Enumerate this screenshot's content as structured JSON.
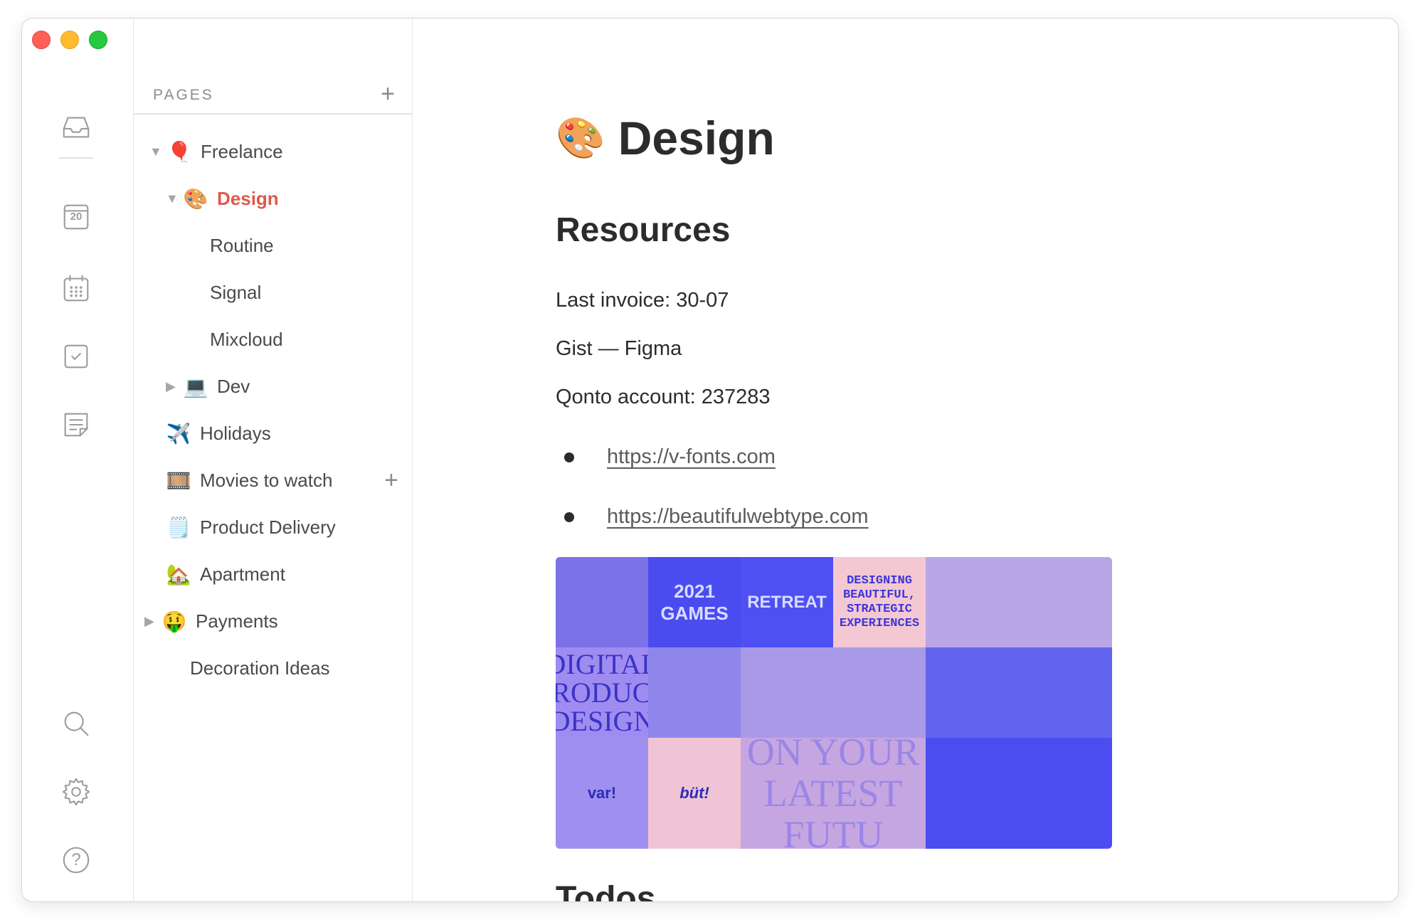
{
  "sidebar": {
    "pages_title": "PAGES",
    "add_symbol": "+",
    "items": [
      {
        "label": "Freelance",
        "emoji": "🎈",
        "arrow": "▼"
      },
      {
        "label": "Design",
        "emoji": "🎨",
        "arrow": "▼"
      },
      {
        "label": "Routine"
      },
      {
        "label": "Signal"
      },
      {
        "label": "Mixcloud"
      },
      {
        "label": "Dev",
        "emoji": "💻",
        "arrow": "▶"
      },
      {
        "label": "Holidays",
        "emoji": "✈️"
      },
      {
        "label": "Movies to watch",
        "emoji": "🎞️",
        "add": "+"
      },
      {
        "label": "Product Delivery",
        "emoji": "🗒️"
      },
      {
        "label": "Apartment",
        "emoji": "🏡"
      },
      {
        "label": "Payments",
        "emoji": "🤑",
        "arrow": "▶"
      },
      {
        "label": "Decoration Ideas"
      }
    ]
  },
  "rail": {
    "calendar_day": "20",
    "help_symbol": "?",
    "icons": [
      "inbox-icon",
      "today-calendar-icon",
      "calendar-grid-icon",
      "checkbox-icon",
      "notes-icon",
      "search-icon",
      "gear-icon",
      "help-icon"
    ]
  },
  "main": {
    "title": "Design",
    "title_emoji": "🎨",
    "section_heading": "Resources",
    "lines": [
      "Last invoice: 30-07",
      "Gist — Figma",
      "Qonto account: 237283"
    ],
    "links": [
      "https://v-fonts.com",
      "https://beautifulwebtype.com"
    ],
    "next_heading": "Todos"
  },
  "moodboard": {
    "tiles": [
      {
        "text": "",
        "bg": "#7b72e8"
      },
      {
        "text": "2021 GAMES",
        "bg": "#4a4cf0"
      },
      {
        "text": "RETREAT",
        "bg": "#4e50f2"
      },
      {
        "text": "DESIGNING BEAUTIFUL, STRATEGIC EXPERIENCES",
        "bg": "#f4c8d2"
      },
      {
        "text": "",
        "bg": "#b8a6e6"
      },
      {
        "text": "DIGITAL PRODUCT DESIGN",
        "bg": "#9f8cf0"
      },
      {
        "text": "",
        "bg": "#8e86ea"
      },
      {
        "text": "",
        "bg": "#a99ae8"
      },
      {
        "text": "",
        "bg": "#6264f0"
      },
      {
        "text": "var!",
        "bg": "#9f90f0"
      },
      {
        "text": "büt!",
        "bg": "#f0c4d4"
      },
      {
        "text": "ON YOUR LATEST FUTU",
        "bg": "#c6a6e0"
      },
      {
        "text": "",
        "bg": "#4b4df0"
      }
    ]
  },
  "colors": {
    "accent": "#e0584c",
    "moodboard_blue": "#4a4cf0"
  }
}
